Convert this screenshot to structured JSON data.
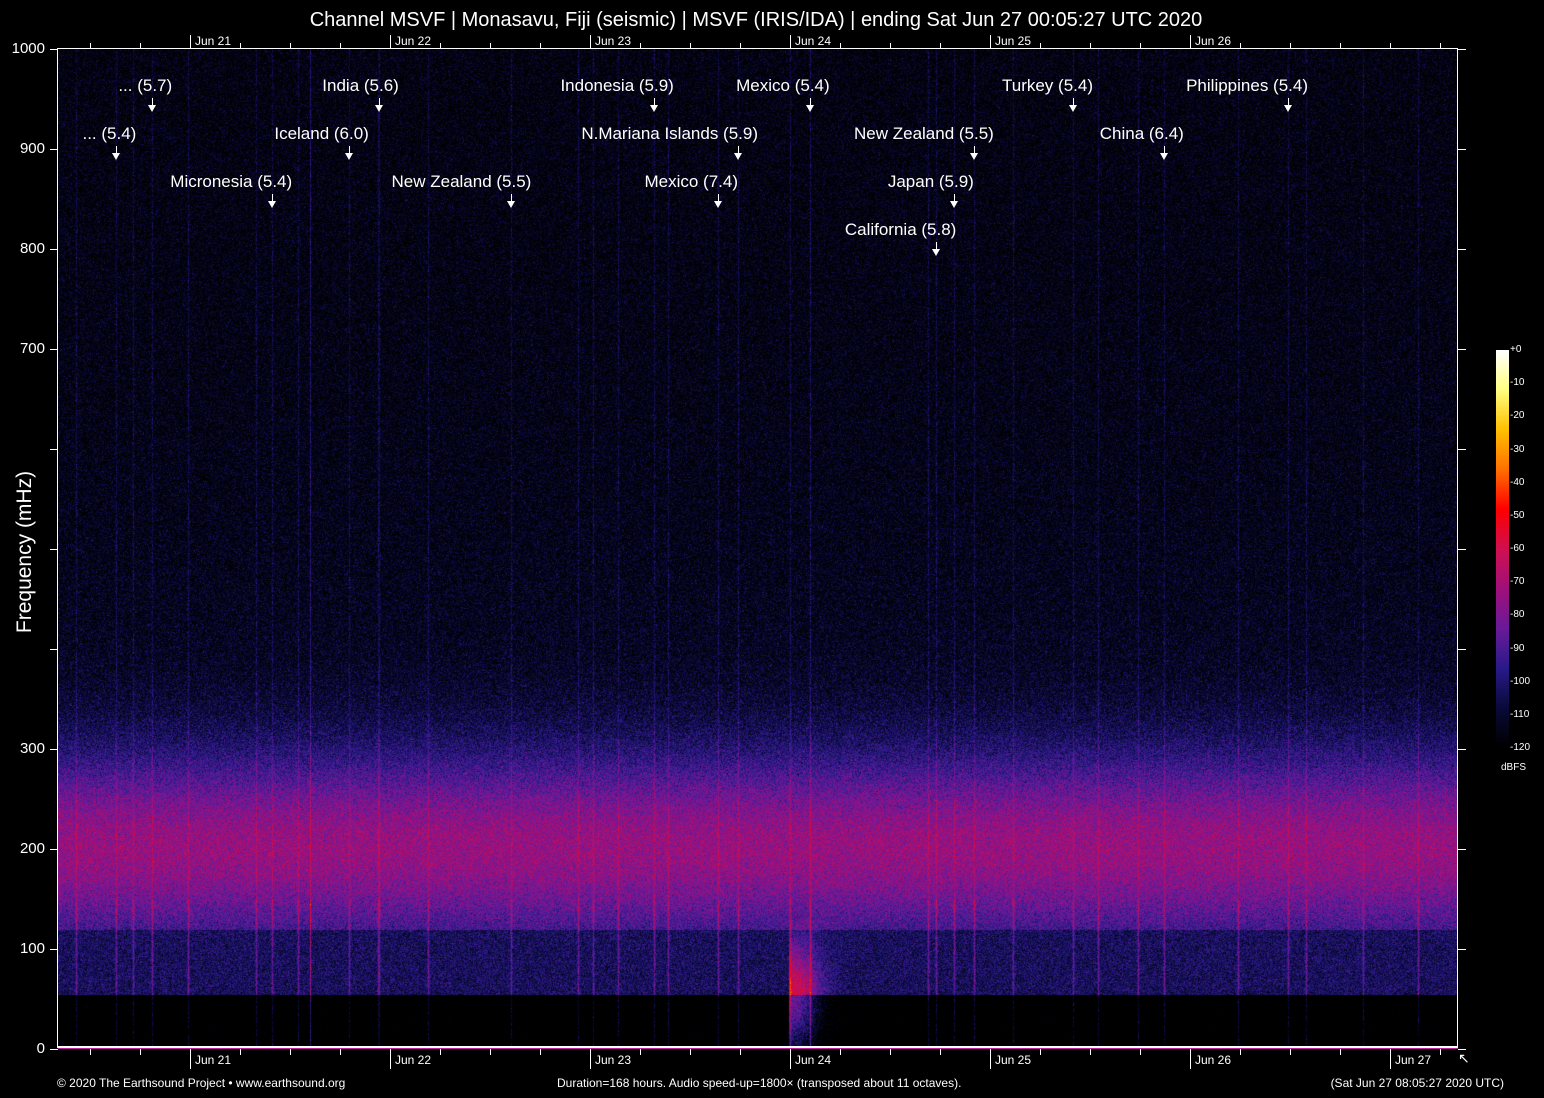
{
  "chart_data": {
    "type": "heatmap",
    "title": "Channel MSVF | Monasavu, Fiji (seismic) | MSVF (IRIS/IDA) | ending Sat Jun 27 00:05:27 UTC 2020",
    "ylabel": "Frequency (mHz)",
    "xlabel": "",
    "ylim": [
      0,
      1000
    ],
    "y_tick_labels": [
      {
        "value": 0,
        "label": "0"
      },
      {
        "value": 100,
        "label": "100"
      },
      {
        "value": 200,
        "label": "200"
      },
      {
        "value": 300,
        "label": "300"
      },
      {
        "value": 700,
        "label": "700"
      },
      {
        "value": 800,
        "label": "800"
      },
      {
        "value": 900,
        "label": "900"
      },
      {
        "value": 1000,
        "label": "1000"
      }
    ],
    "y_ticks": [
      0,
      100,
      200,
      300,
      400,
      500,
      600,
      700,
      800,
      900,
      1000
    ],
    "xlim_hours": [
      0,
      168
    ],
    "x_day_ticks": [
      {
        "hour": 15.84,
        "label": "Jun 21"
      },
      {
        "hour": 39.84,
        "label": "Jun 22"
      },
      {
        "hour": 63.84,
        "label": "Jun 23"
      },
      {
        "hour": 87.84,
        "label": "Jun 24"
      },
      {
        "hour": 111.84,
        "label": "Jun 25"
      },
      {
        "hour": 135.84,
        "label": "Jun 26"
      }
    ],
    "x_bottom_extra_label": {
      "hour": 159.84,
      "label": "Jun 27"
    },
    "colorbar": {
      "unit": "dBFS",
      "range": [
        -120,
        0
      ],
      "tick_labels": [
        "+0",
        "-10",
        "-20",
        "-30",
        "-40",
        "-50",
        "-60",
        "-70",
        "-80",
        "-90",
        "-100",
        "-110",
        "-120"
      ],
      "colors": [
        "#000000",
        "#0a0a3a",
        "#2a1a8a",
        "#6a1a9a",
        "#a0107a",
        "#d01050",
        "#ff0000",
        "#ff7000",
        "#ffc000",
        "#ffff80",
        "#ffffff"
      ]
    },
    "annotations": [
      {
        "label": "... (5.7)",
        "hour": 11.3,
        "row": 1
      },
      {
        "label": "... (5.4)",
        "hour": 7.0,
        "row": 2
      },
      {
        "label": "Micronesia (5.4)",
        "hour": 25.7,
        "row": 3
      },
      {
        "label": "India (5.6)",
        "hour": 38.5,
        "row": 1
      },
      {
        "label": "Iceland (6.0)",
        "hour": 34.9,
        "row": 2
      },
      {
        "label": "New Zealand (5.5)",
        "hour": 54.4,
        "row": 3
      },
      {
        "label": "Indonesia (5.9)",
        "hour": 71.5,
        "row": 1
      },
      {
        "label": "N.Mariana Islands (5.9)",
        "hour": 81.6,
        "row": 2
      },
      {
        "label": "Mexico (7.4)",
        "hour": 79.2,
        "row": 3
      },
      {
        "label": "Mexico (5.4)",
        "hour": 90.2,
        "row": 1
      },
      {
        "label": "New Zealand (5.5)",
        "hour": 109.9,
        "row": 2
      },
      {
        "label": "Japan (5.9)",
        "hour": 107.5,
        "row": 3
      },
      {
        "label": "California (5.8)",
        "hour": 105.4,
        "row": 4
      },
      {
        "label": "Turkey (5.4)",
        "hour": 121.8,
        "row": 1
      },
      {
        "label": "China (6.4)",
        "hour": 132.7,
        "row": 2
      },
      {
        "label": "Philippines (5.4)",
        "hour": 147.6,
        "row": 1
      }
    ]
  },
  "footer": {
    "copyright": "© 2020 The Earthsound Project • www.earthsound.org",
    "duration": "Duration=168 hours. Audio speed-up=1800× (transposed about 11 octaves).",
    "timestamp": "(Sat Jun 27 08:05:27 2020 UTC)"
  }
}
